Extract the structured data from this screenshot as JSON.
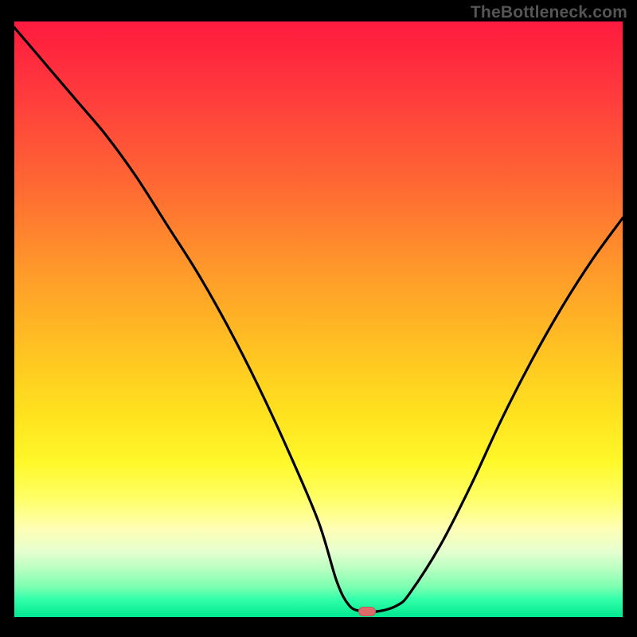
{
  "watermark": "TheBottleneck.com",
  "chart_data": {
    "type": "line",
    "title": "",
    "xlabel": "",
    "ylabel": "",
    "xlim": [
      0,
      100
    ],
    "ylim": [
      0,
      100
    ],
    "grid": false,
    "legend": false,
    "background": "rainbow-vertical-gradient",
    "series": [
      {
        "name": "bottleneck-curve",
        "x": [
          0,
          5,
          10,
          15,
          20,
          25,
          30,
          35,
          40,
          45,
          50,
          53,
          55,
          57,
          60,
          63,
          65,
          70,
          75,
          80,
          85,
          90,
          95,
          100
        ],
        "y": [
          99,
          93,
          87,
          81,
          74,
          66,
          58,
          49,
          39,
          28,
          16,
          6,
          2,
          1,
          1,
          2,
          4,
          12,
          22,
          33,
          43,
          52,
          60,
          67
        ]
      }
    ],
    "marker": {
      "x": 58,
      "y": 1,
      "shape": "pill",
      "color": "#e06a6a"
    },
    "gradient_stops": [
      {
        "pct": 0,
        "color": "#ff1a3f"
      },
      {
        "pct": 12,
        "color": "#ff3a3d"
      },
      {
        "pct": 28,
        "color": "#ff6a33"
      },
      {
        "pct": 42,
        "color": "#ff9a2a"
      },
      {
        "pct": 55,
        "color": "#ffc222"
      },
      {
        "pct": 66,
        "color": "#ffe21f"
      },
      {
        "pct": 74,
        "color": "#fff82a"
      },
      {
        "pct": 80,
        "color": "#ffff66"
      },
      {
        "pct": 85,
        "color": "#ffffb3"
      },
      {
        "pct": 89,
        "color": "#e6ffd0"
      },
      {
        "pct": 92,
        "color": "#b6ffc0"
      },
      {
        "pct": 95,
        "color": "#7affb0"
      },
      {
        "pct": 97,
        "color": "#33ffaa"
      },
      {
        "pct": 100,
        "color": "#00e890"
      }
    ]
  }
}
